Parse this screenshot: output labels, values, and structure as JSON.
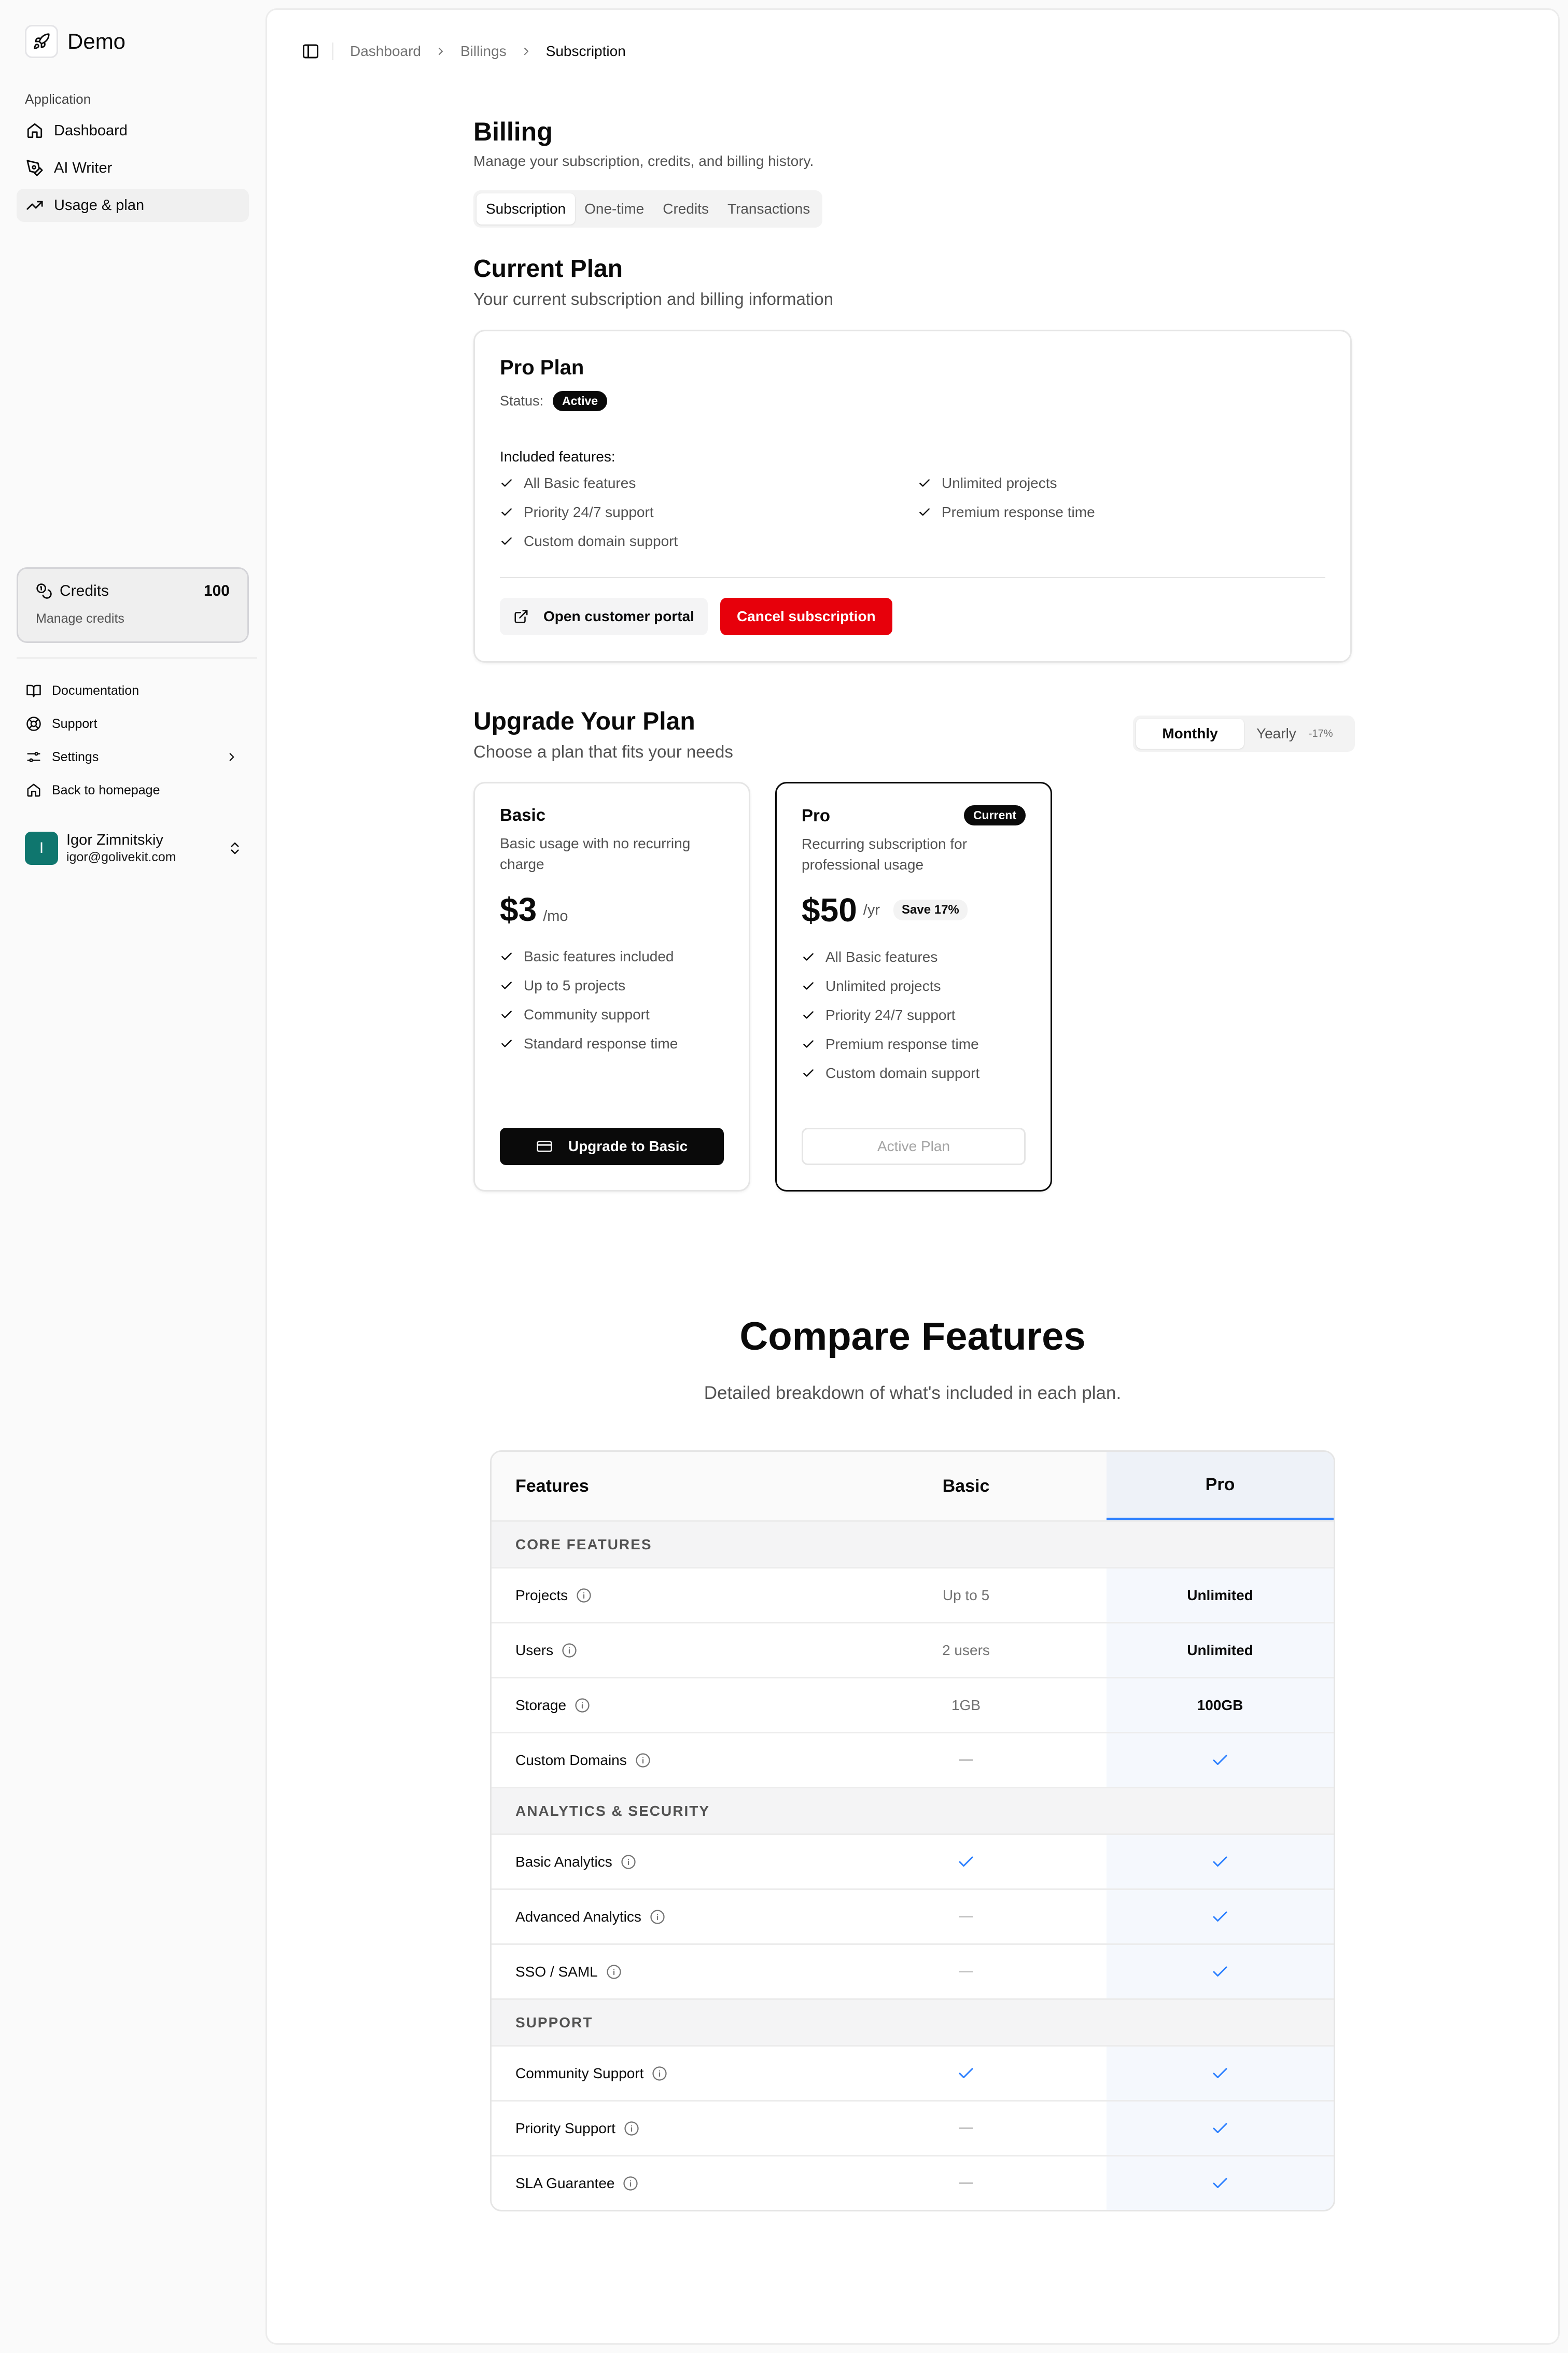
{
  "app": {
    "name": "Demo"
  },
  "sidebar": {
    "section_label": "Application",
    "items": [
      {
        "label": "Dashboard",
        "icon": "home-icon"
      },
      {
        "label": "AI Writer",
        "icon": "pen-icon"
      },
      {
        "label": "Usage & plan",
        "icon": "trending-up-icon"
      }
    ],
    "credits": {
      "label": "Credits",
      "value": "100",
      "sub": "Manage credits"
    },
    "secondary": [
      {
        "label": "Documentation",
        "icon": "book-icon"
      },
      {
        "label": "Support",
        "icon": "lifebuoy-icon"
      },
      {
        "label": "Settings",
        "icon": "sliders-icon"
      },
      {
        "label": "Back to homepage",
        "icon": "home-icon"
      }
    ],
    "user": {
      "initial": "I",
      "name": "Igor Zimnitskiy",
      "email": "igor@golivekit.com"
    }
  },
  "breadcrumb": [
    "Dashboard",
    "Billings",
    "Subscription"
  ],
  "billing": {
    "title": "Billing",
    "subtitle": "Manage your subscription, credits, and billing history.",
    "tabs": [
      "Subscription",
      "One-time",
      "Credits",
      "Transactions"
    ]
  },
  "current_plan": {
    "title": "Current Plan",
    "subtitle": "Your current subscription and billing information",
    "plan_name": "Pro Plan",
    "status_label": "Status:",
    "status": "Active",
    "included_label": "Included features:",
    "features_left": [
      "All Basic features",
      "Priority 24/7 support",
      "Custom domain support"
    ],
    "features_right": [
      "Unlimited projects",
      "Premium response time"
    ],
    "portal_button": "Open customer portal",
    "cancel_button": "Cancel subscription"
  },
  "upgrade": {
    "title": "Upgrade Your Plan",
    "subtitle": "Choose a plan that fits your needs",
    "toggle_monthly": "Monthly",
    "toggle_yearly": "Yearly",
    "toggle_discount": "-17%",
    "plans": [
      {
        "name": "Basic",
        "desc": "Basic usage with no recurring charge",
        "price": "$3",
        "period": "/mo",
        "features": [
          "Basic features included",
          "Up to 5 projects",
          "Community support",
          "Standard response time"
        ],
        "button": "Upgrade to Basic"
      },
      {
        "name": "Pro",
        "badge": "Current",
        "desc": "Recurring subscription for professional usage",
        "price": "$50",
        "period": "/yr",
        "save": "Save 17%",
        "features": [
          "All Basic features",
          "Unlimited projects",
          "Priority 24/7 support",
          "Premium response time",
          "Custom domain support"
        ],
        "button": "Active Plan"
      }
    ]
  },
  "compare": {
    "title": "Compare Features",
    "subtitle": "Detailed breakdown of what's included in each plan.",
    "headers": [
      "Features",
      "Basic",
      "Pro"
    ],
    "groups": [
      {
        "name": "CORE FEATURES",
        "rows": [
          {
            "feature": "Projects",
            "basic": "Up to 5",
            "pro": "Unlimited"
          },
          {
            "feature": "Users",
            "basic": "2 users",
            "pro": "Unlimited"
          },
          {
            "feature": "Storage",
            "basic": "1GB",
            "pro": "100GB"
          },
          {
            "feature": "Custom Domains",
            "basic": false,
            "pro": true
          }
        ]
      },
      {
        "name": "ANALYTICS & SECURITY",
        "rows": [
          {
            "feature": "Basic Analytics",
            "basic": true,
            "pro": true
          },
          {
            "feature": "Advanced Analytics",
            "basic": false,
            "pro": true
          },
          {
            "feature": "SSO / SAML",
            "basic": false,
            "pro": true
          }
        ]
      },
      {
        "name": "SUPPORT",
        "rows": [
          {
            "feature": "Community Support",
            "basic": true,
            "pro": true
          },
          {
            "feature": "Priority Support",
            "basic": false,
            "pro": true
          },
          {
            "feature": "SLA Guarantee",
            "basic": false,
            "pro": true
          }
        ]
      }
    ]
  },
  "colors": {
    "accent": "#2b7fff",
    "danger": "#e7000b",
    "dark": "#0a0a0a",
    "check": "#2b7fff",
    "avatar": "#0f766e"
  }
}
